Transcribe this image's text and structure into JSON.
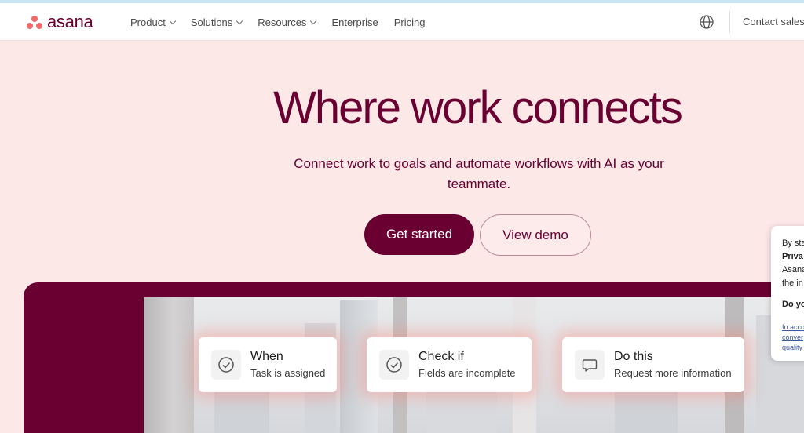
{
  "header": {
    "brand": "asana",
    "nav": [
      {
        "label": "Product",
        "has_menu": true
      },
      {
        "label": "Solutions",
        "has_menu": true
      },
      {
        "label": "Resources",
        "has_menu": true
      },
      {
        "label": "Enterprise",
        "has_menu": false
      },
      {
        "label": "Pricing",
        "has_menu": false
      }
    ],
    "language_icon": "globe-icon",
    "contact_label": "Contact sales"
  },
  "hero": {
    "title": "Where work connects",
    "subtitle": "Connect work to goals and automate workflows with AI as your teammate.",
    "primary_cta": "Get started",
    "secondary_cta": "View demo"
  },
  "workflow_cards": [
    {
      "title": "When",
      "description": "Task is assigned",
      "icon": "check-circle-icon"
    },
    {
      "title": "Check if",
      "description": "Fields are incomplete",
      "icon": "check-circle-icon"
    },
    {
      "title": "Do this",
      "description": "Request more information",
      "icon": "speech-bubble-icon"
    }
  ],
  "cookie_banner": {
    "lines": [
      "By sta",
      "Priva",
      "Asana",
      "the in"
    ],
    "question": "Do yo",
    "fine_print": [
      "In acco",
      "conver",
      "quality"
    ]
  },
  "colors": {
    "brand_plum": "#690031",
    "hero_background": "#fde8e8",
    "logo_coral": "#f06a6a"
  }
}
